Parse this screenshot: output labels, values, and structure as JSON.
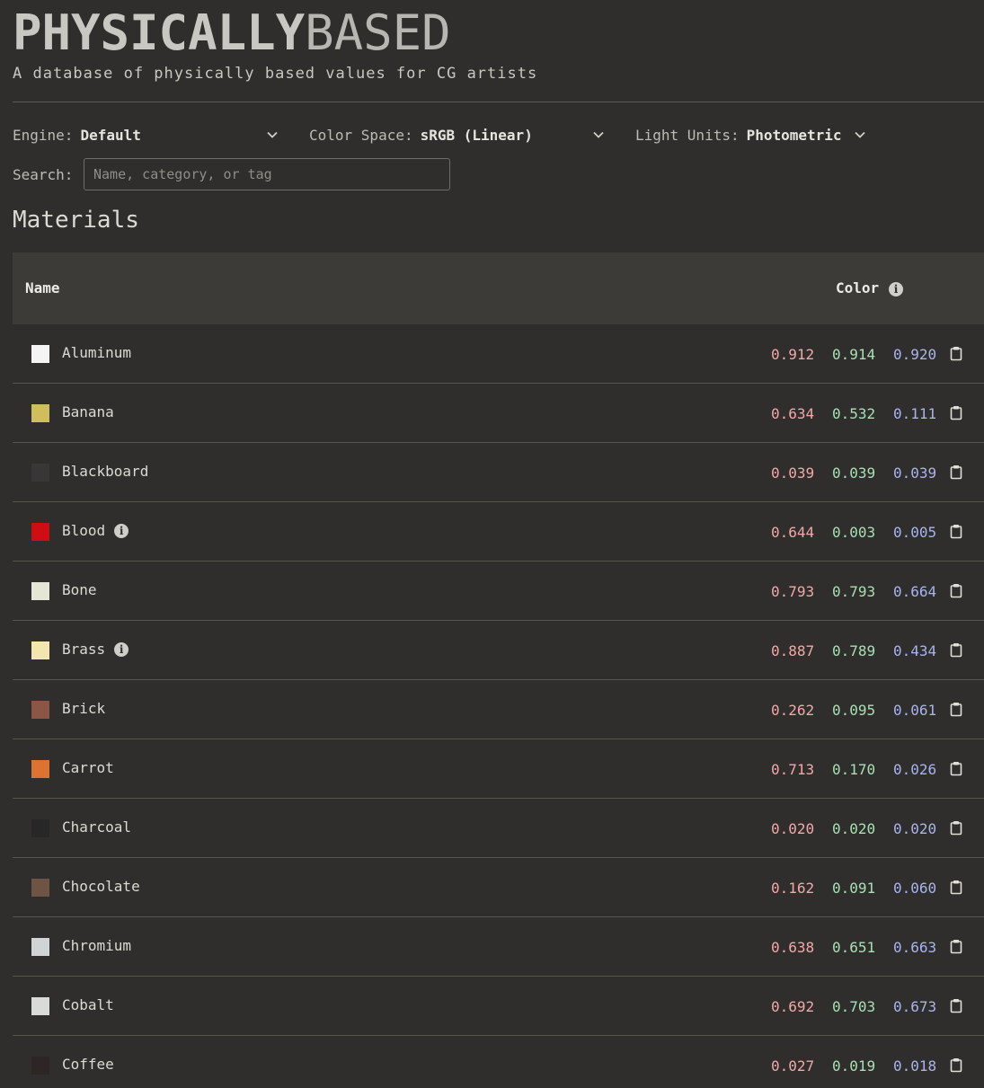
{
  "header": {
    "logo_bold": "PHYSICALLY",
    "logo_light": "BASED",
    "tagline": "A database of physically based values for CG artists"
  },
  "controls": {
    "engine": {
      "label": "Engine:",
      "value": "Default"
    },
    "color_space": {
      "label": "Color Space:",
      "value": "sRGB (Linear)"
    },
    "light_units": {
      "label": "Light Units:",
      "value": "Photometric"
    },
    "search": {
      "label": "Search:",
      "placeholder": "Name, category, or tag",
      "value": ""
    }
  },
  "section_title": "Materials",
  "table": {
    "headers": {
      "name": "Name",
      "color": "Color"
    },
    "rows": [
      {
        "name": "Aluminum",
        "info": false,
        "swatch": "#f4f4f5",
        "r": "0.912",
        "g": "0.914",
        "b": "0.920"
      },
      {
        "name": "Banana",
        "info": false,
        "swatch": "#cfbe5c",
        "r": "0.634",
        "g": "0.532",
        "b": "0.111"
      },
      {
        "name": "Blackboard",
        "info": false,
        "swatch": "#373737",
        "r": "0.039",
        "g": "0.039",
        "b": "0.039"
      },
      {
        "name": "Blood",
        "info": true,
        "swatch": "#d00d12",
        "r": "0.644",
        "g": "0.003",
        "b": "0.005"
      },
      {
        "name": "Bone",
        "info": false,
        "swatch": "#e6e6d6",
        "r": "0.793",
        "g": "0.793",
        "b": "0.664"
      },
      {
        "name": "Brass",
        "info": true,
        "swatch": "#f2e6ae",
        "r": "0.887",
        "g": "0.789",
        "b": "0.434"
      },
      {
        "name": "Brick",
        "info": false,
        "swatch": "#8b5645",
        "r": "0.262",
        "g": "0.095",
        "b": "0.061"
      },
      {
        "name": "Carrot",
        "info": false,
        "swatch": "#dc7330",
        "r": "0.713",
        "g": "0.170",
        "b": "0.026"
      },
      {
        "name": "Charcoal",
        "info": false,
        "swatch": "#272727",
        "r": "0.020",
        "g": "0.020",
        "b": "0.020"
      },
      {
        "name": "Chocolate",
        "info": false,
        "swatch": "#6f5345",
        "r": "0.162",
        "g": "0.091",
        "b": "0.060"
      },
      {
        "name": "Chromium",
        "info": false,
        "swatch": "#d1d4d5",
        "r": "0.638",
        "g": "0.651",
        "b": "0.663"
      },
      {
        "name": "Cobalt",
        "info": false,
        "swatch": "#d9dbd6",
        "r": "0.692",
        "g": "0.703",
        "b": "0.673"
      },
      {
        "name": "Coffee",
        "info": false,
        "swatch": "#2e2625",
        "r": "0.027",
        "g": "0.019",
        "b": "0.018"
      }
    ]
  },
  "colors": {
    "background": "#2f2e2c",
    "header_bg": "#3c3b37",
    "red_value": "#f2a8a8",
    "green_value": "#a8e0b4",
    "blue_value": "#a8b4ee"
  },
  "icons": {
    "dropdown": "chevron-down-icon",
    "info": "info-icon",
    "copy": "clipboard-icon"
  }
}
